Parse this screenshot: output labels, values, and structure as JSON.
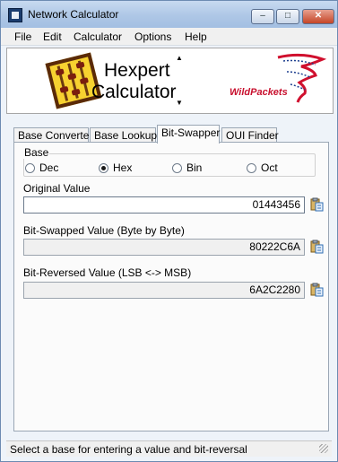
{
  "window": {
    "title": "Network Calculator",
    "controls": {
      "minimize": "–",
      "maximize": "□",
      "close": "✕"
    }
  },
  "menu": [
    "File",
    "Edit",
    "Calculator",
    "Options",
    "Help"
  ],
  "banner": {
    "product_line1": "Hexpert",
    "product_line2": "Calculator",
    "company_logo": "WildPackets",
    "scroll_up": "▲",
    "scroll_down": "▼"
  },
  "tabs": [
    {
      "label": "Base Converter",
      "active": false
    },
    {
      "label": "Base Lookup",
      "active": false
    },
    {
      "label": "Bit-Swapper",
      "active": true
    },
    {
      "label": "OUI Finder",
      "active": false
    }
  ],
  "base_group": {
    "label": "Base",
    "options": [
      {
        "label": "Dec",
        "selected": false
      },
      {
        "label": "Hex",
        "selected": true
      },
      {
        "label": "Bin",
        "selected": false
      },
      {
        "label": "Oct",
        "selected": false
      }
    ]
  },
  "fields": {
    "original": {
      "label": "Original Value",
      "value": "01443456"
    },
    "byte_swapped": {
      "label": "Bit-Swapped Value (Byte by Byte)",
      "value": "80222C6A"
    },
    "bit_reversed": {
      "label": "Bit-Reversed Value (LSB <-> MSB)",
      "value": "6A2C2280"
    }
  },
  "icons": {
    "copy": "clipboard-copy-icon",
    "app": "calculator-window-icon"
  },
  "status": "Select a base for entering a value and bit-reversal",
  "colors": {
    "titlebar": "#aec7e6",
    "close_button": "#c54527",
    "logo_red": "#c8102e",
    "abacus_frame": "#f7d230"
  }
}
